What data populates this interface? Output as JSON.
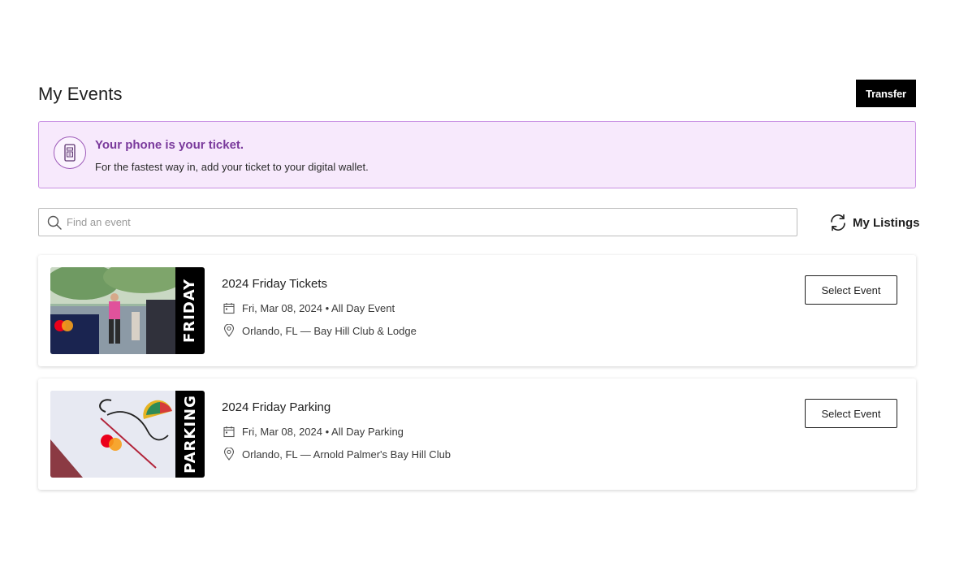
{
  "header": {
    "title": "My Events",
    "transfer_label": "Transfer"
  },
  "banner": {
    "icon": "phone-ticket-icon",
    "title": "Your phone is your ticket.",
    "text": "For the fastest way in, add your ticket to your digital wallet.",
    "accent_color": "#7a3a9c",
    "background_color": "#f7e9fc",
    "border_color": "#c88fe3"
  },
  "search": {
    "placeholder": "Find an event",
    "value": ""
  },
  "listings": {
    "label": "My Listings",
    "icon": "refresh-icon"
  },
  "events": [
    {
      "strip_label": "FRIDAY",
      "name": "2024 Friday Tickets",
      "date": "Fri, Mar 08, 2024 • All Day Event",
      "venue": "Orlando, FL — Bay Hill Club & Lodge",
      "button_label": "Select Event"
    },
    {
      "strip_label": "PARKING",
      "name": "2024 Friday Parking",
      "date": "Fri, Mar 08, 2024 • All Day Parking",
      "venue": "Orlando, FL — Arnold Palmer's Bay Hill Club",
      "button_label": "Select Event"
    }
  ]
}
